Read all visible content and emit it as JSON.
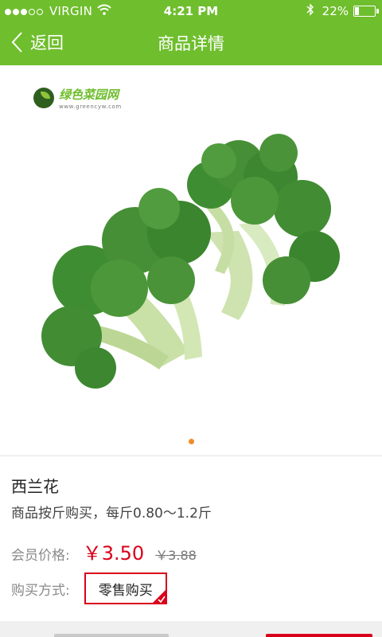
{
  "status_bar": {
    "carrier": "VIRGIN",
    "time": "4:21 PM",
    "battery_text": "22%",
    "battery_level": 0.22,
    "signal_bars_filled": 3,
    "signal_bars_total": 5
  },
  "nav": {
    "back_label": "返回",
    "title": "商品详情"
  },
  "gallery": {
    "logo_name": "绿色菜园网",
    "logo_url": "www.greencyw.com",
    "image_subject": "broccoli",
    "page_count": 1,
    "active_page": 1
  },
  "product": {
    "name": "西兰花",
    "description": "商品按斤购买，每斤0.80～1.2斤",
    "price_label": "会员价格:",
    "price": "￥3.50",
    "original_price": "￥3.88",
    "buy_label": "购买方式:",
    "buy_option": "零售购买"
  },
  "colors": {
    "brand_green": "#6fbe2d",
    "price_red": "#d9001b",
    "pager_orange": "#f08c2c"
  }
}
